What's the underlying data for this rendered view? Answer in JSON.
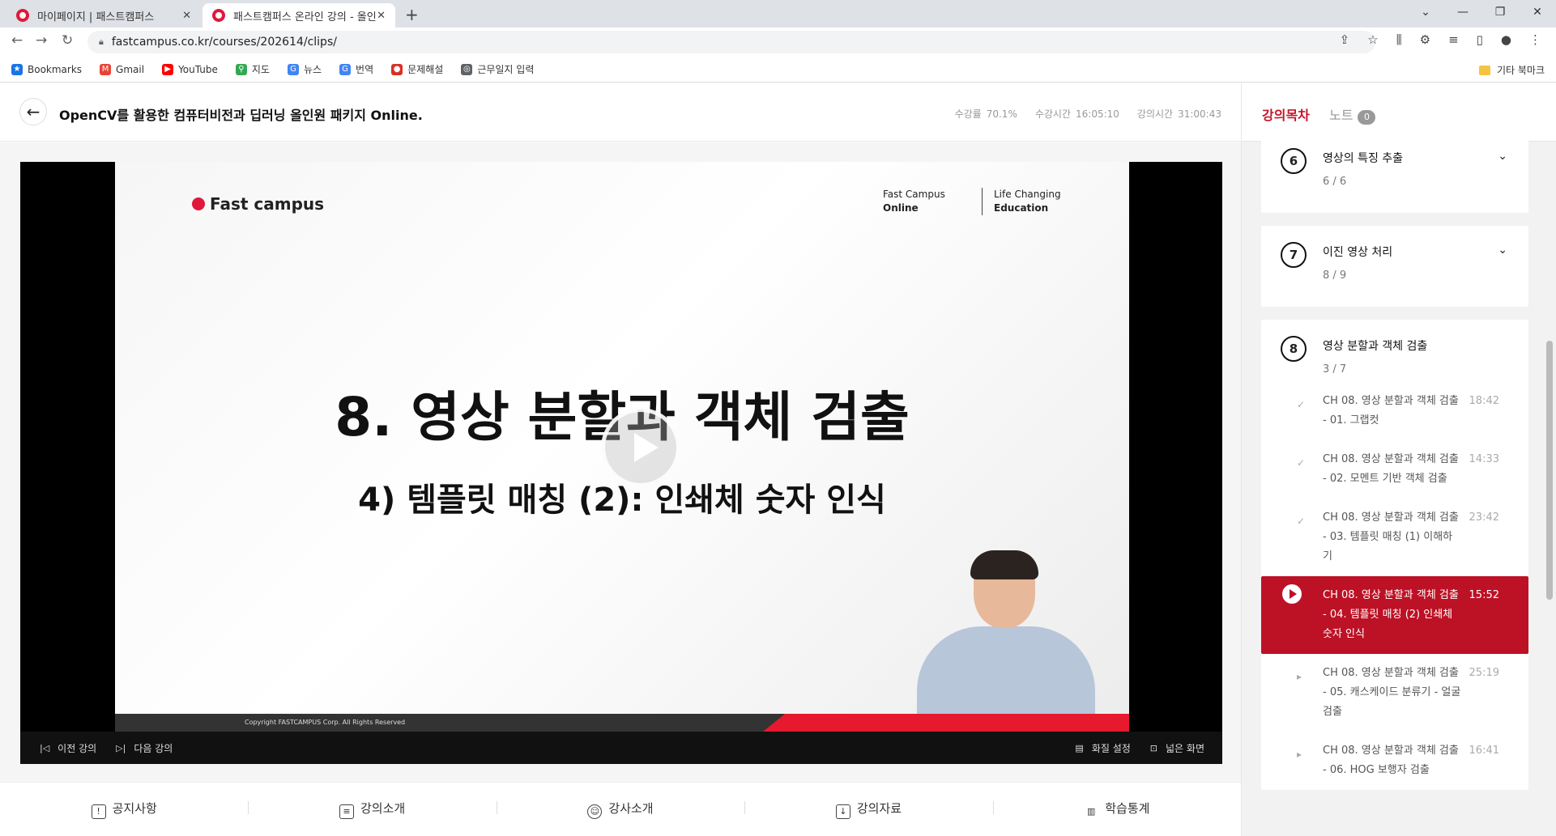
{
  "browser": {
    "tabs": [
      {
        "title": "마이페이지 | 패스트캠퍼스",
        "active": false
      },
      {
        "title": "패스트캠퍼스 온라인 강의 - 올인",
        "active": true
      }
    ],
    "url": "fastcampus.co.kr/courses/202614/clips/",
    "bookmarks": [
      {
        "label": "Bookmarks",
        "icon": "star-icon",
        "color": "#1a73e8"
      },
      {
        "label": "Gmail",
        "icon": "gmail-icon",
        "color": "#ea4335"
      },
      {
        "label": "YouTube",
        "icon": "youtube-icon",
        "color": "#ff0000"
      },
      {
        "label": "지도",
        "icon": "maps-icon",
        "color": "#34a853"
      },
      {
        "label": "뉴스",
        "icon": "news-icon",
        "color": "#4285f4"
      },
      {
        "label": "번역",
        "icon": "translate-icon",
        "color": "#4285f4"
      },
      {
        "label": "문제해설",
        "icon": "bookmark-site-icon",
        "color": "#d93025"
      },
      {
        "label": "근무일지 입력",
        "icon": "globe-icon",
        "color": "#5f6368"
      }
    ],
    "other_bookmarks": "기타 북마크"
  },
  "course": {
    "title": "OpenCV를 활용한 컴퓨터비전과 딥러닝 올인원 패키지 Online.",
    "stats": [
      {
        "label": "수강률",
        "value": "70.1%"
      },
      {
        "label": "수강시간",
        "value": "16:05:10"
      },
      {
        "label": "강의시간",
        "value": "31:00:43"
      }
    ]
  },
  "player": {
    "slide": {
      "logo": "Fast campus",
      "tag_left": [
        "Fast Campus",
        "Online"
      ],
      "tag_right": [
        "Life Changing",
        "Education"
      ],
      "title": "8. 영상 분할과 객체 검출",
      "subtitle": "4) 템플릿 매칭 (2): 인쇄체 숫자 인식",
      "copyright": "Copyright FASTCAMPUS Corp. All Rights Reserved"
    },
    "controls": {
      "prev": "이전 강의",
      "next": "다음 강의",
      "quality": "화질 설정",
      "wide": "넓은 화면"
    }
  },
  "bottom_tabs": [
    {
      "label": "공지사항",
      "icon": "notice-icon"
    },
    {
      "label": "강의소개",
      "icon": "clipboard-icon"
    },
    {
      "label": "강사소개",
      "icon": "user-icon"
    },
    {
      "label": "강의자료",
      "icon": "download-icon"
    },
    {
      "label": "학습통계",
      "icon": "stats-icon"
    }
  ],
  "sidebar": {
    "tabs": [
      {
        "label": "강의목차",
        "active": true
      },
      {
        "label": "노트",
        "count": "0"
      }
    ],
    "chapters": [
      {
        "num": "6",
        "title": "영상의 특징 추출",
        "progress": "6 / 6",
        "expanded": false
      },
      {
        "num": "7",
        "title": "이진 영상 처리",
        "progress": "8 / 9",
        "expanded": false
      },
      {
        "num": "8",
        "title": "영상 분할과 객체 검출",
        "progress": "3 / 7",
        "expanded": true,
        "clips": [
          {
            "title": "CH 08. 영상 분할과 객체 검출 - 01. 그랩컷",
            "time": "18:42",
            "status": "done"
          },
          {
            "title": "CH 08. 영상 분할과 객체 검출 - 02. 모멘트 기반 객체 검출",
            "time": "14:33",
            "status": "done"
          },
          {
            "title": "CH 08. 영상 분할과 객체 검출 - 03. 템플릿 매칭 (1) 이해하기",
            "time": "23:42",
            "status": "done"
          },
          {
            "title": "CH 08. 영상 분할과 객체 검출 - 04. 템플릿 매칭 (2) 인쇄체 숫자 인식",
            "time": "15:52",
            "status": "playing"
          },
          {
            "title": "CH 08. 영상 분할과 객체 검출 - 05. 캐스케이드 분류기 - 얼굴 검출",
            "time": "25:19",
            "status": "todo"
          },
          {
            "title": "CH 08. 영상 분할과 객체 검출 - 06. HOG 보행자 검출",
            "time": "16:41",
            "status": "todo"
          }
        ]
      }
    ]
  }
}
